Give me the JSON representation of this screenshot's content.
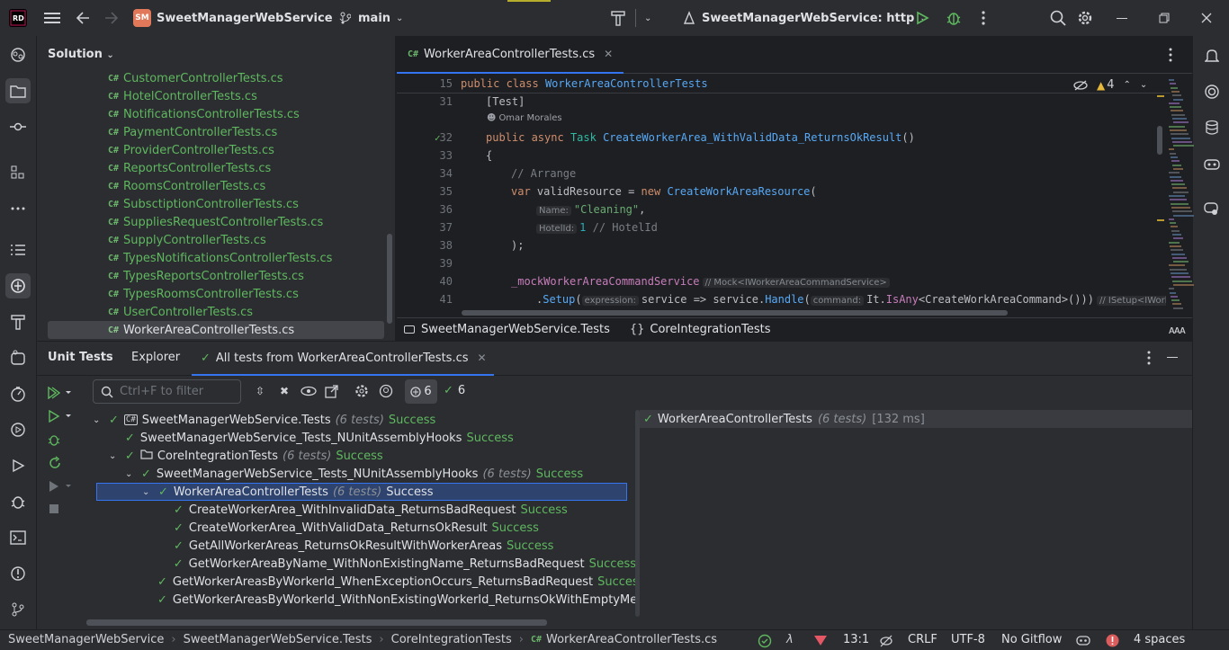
{
  "titlebar": {
    "project_badge": "SM",
    "project_name": "SweetManagerWebService",
    "branch": "main",
    "run_config": "SweetManagerWebService: http"
  },
  "solution": {
    "title": "Solution",
    "files": [
      "CustomerControllerTests.cs",
      "HotelControllerTests.cs",
      "NotificationsControllerTests.cs",
      "PaymentControllerTests.cs",
      "ProviderControllerTests.cs",
      "ReportsControllerTests.cs",
      "RoomsControllerTests.cs",
      "SubsctiptionControllerTests.cs",
      "SuppliesRequestControllerTests.cs",
      "SupplyControllerTests.cs",
      "TypesNotificationsControllerTests.cs",
      "TypesReportsControllerTests.cs",
      "TypesRoomsControllerTests.cs",
      "UserControllerTests.cs",
      "WorkerAreaControllerTests.cs"
    ],
    "file_icon": "C#"
  },
  "editor": {
    "tab_label": "WorkerAreaControllerTests.cs",
    "tab_icon": "C#",
    "warning_count": "4",
    "author": "Omar Morales",
    "line_numbers": [
      "15",
      "31",
      "32",
      "33",
      "34",
      "35",
      "36",
      "37",
      "38",
      "39",
      "40",
      "41"
    ],
    "breadcrumb_project": "SweetManagerWebService.Tests",
    "breadcrumb_class": "CoreIntegrationTests",
    "code": {
      "l15_kw": "public class",
      "l15_name": "WorkerAreaControllerTests",
      "l31": "[Test]",
      "l32_kw": "public async",
      "l32_type": "Task",
      "l32_name": "CreateWorkerArea_WithValidData_ReturnsOkResult",
      "l32_tail": "()",
      "l33": "{",
      "l34": "// Arrange",
      "l35_kw": "var",
      "l35_mid": "validResource =",
      "l35_new": "new",
      "l35_type": "CreateWorkAreaResource",
      "l35_tail": "(",
      "l36_hint": "Name:",
      "l36_val": "\"Cleaning\"",
      "l36_tail": ",",
      "l37_hint": "HotelId:",
      "l37_val": "1",
      "l37_cm": "// HotelId",
      "l38": ");",
      "l40_field": "_mockWorkerAreaCommandService",
      "l40_hint": "// Mock<IWorkerAreaCommandService>",
      "l41_pre": ".",
      "l41_setup": "Setup",
      "l41_open": "(",
      "l41_hint": "expression:",
      "l41_a": "service => service.",
      "l41_handle": "Handle",
      "l41_b": "(",
      "l41_hint2": "command:",
      "l41_it": "It.",
      "l41_isany": "IsAny",
      "l41_c": "<CreateWorkAreaCommand>()))",
      "l41_hint3": "// ISetup<IWorkerAre"
    }
  },
  "unit_tests": {
    "tabs": [
      "Unit Tests",
      "Explorer",
      "All tests from WorkerAreaControllerTests.cs"
    ],
    "filter_placeholder": "Ctrl+F to filter",
    "count_total": "6",
    "count_passed": "6",
    "tree": [
      {
        "label": "SweetManagerWebService.Tests",
        "count": "(6 tests)",
        "status": "Success"
      },
      {
        "label": "SweetManagerWebService_Tests_NUnitAssemblyHooks",
        "count": "",
        "status": "Success"
      },
      {
        "label": "CoreIntegrationTests",
        "count": "(6 tests)",
        "status": "Success"
      },
      {
        "label": "SweetManagerWebService_Tests_NUnitAssemblyHooks",
        "count": "(6 tests)",
        "status": "Success"
      },
      {
        "label": "WorkerAreaControllerTests",
        "count": "(6 tests)",
        "status": "Success"
      },
      {
        "label": "CreateWorkerArea_WithInvalidData_ReturnsBadRequest",
        "count": "",
        "status": "Success"
      },
      {
        "label": "CreateWorkerArea_WithValidData_ReturnsOkResult",
        "count": "",
        "status": "Success"
      },
      {
        "label": "GetAllWorkerAreas_ReturnsOkResultWithWorkerAreas",
        "count": "",
        "status": "Success"
      },
      {
        "label": "GetWorkerAreaByName_WithNonExistingName_ReturnsBadRequest",
        "count": "",
        "status": "Success"
      },
      {
        "label": "GetWorkerAreasByWorkerId_WhenExceptionOccurs_ReturnsBadRequest",
        "count": "",
        "status": "Success"
      },
      {
        "label": "GetWorkerAreasByWorkerId_WithNonExistingWorkerId_ReturnsOkWithEmptyMes",
        "count": "",
        "status": ""
      }
    ],
    "detail": {
      "label": "WorkerAreaControllerTests",
      "count": "(6 tests)",
      "time": "[132 ms]"
    }
  },
  "statusbar": {
    "crumbs": [
      "SweetManagerWebService",
      "SweetManagerWebService.Tests",
      "CoreIntegrationTests",
      "WorkerAreaControllerTests.cs"
    ],
    "position": "13:1",
    "line_sep": "CRLF",
    "encoding": "UTF-8",
    "vcs": "No Gitflow",
    "indent": "4 spaces"
  },
  "colors": {
    "accent": "#3574f0",
    "success": "#5fb85f",
    "selection": "#2e436e"
  }
}
